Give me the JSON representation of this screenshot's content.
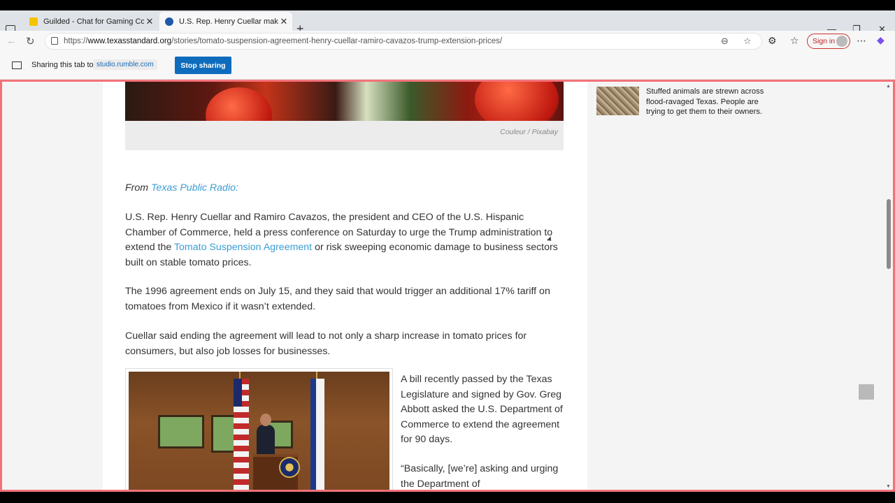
{
  "browser": {
    "tabs": [
      {
        "title": "Guilded - Chat for Gaming Comm",
        "active": false,
        "favicon": "guilded-icon",
        "favicon_color": "#f5c400"
      },
      {
        "title": "U.S. Rep. Henry Cuellar make",
        "active": true,
        "favicon": "texas-standard-icon",
        "favicon_color": "#1e5aa8"
      }
    ],
    "new_tab_label": "+",
    "url_prefix": "https://",
    "url_domain": "www.texasstandard.org",
    "url_path": "/stories/tomato-suspension-agreement-henry-cuellar-ramiro-cavazos-trump-extension-prices/",
    "sign_in_label": "Sign in"
  },
  "sharing": {
    "label": "Sharing this tab to",
    "domain": "studio.rumble.com",
    "stop_label": "Stop sharing"
  },
  "article": {
    "photo_credit": "Couleur / Pixabay",
    "from_prefix": "From",
    "from_source": "Texas Public Radio:",
    "p1_a": "U.S. Rep. Henry Cuellar and Ramiro Cavazos, the president and CEO of the U.S. Hispanic Chamber of Commerce, held a press conference on Saturday to urge the Trump administration to extend the ",
    "p1_link": "Tomato Suspension Agreement",
    "p1_b": " or risk sweeping economic damage to business sectors built on stable tomato prices.",
    "p2": "The 1996 agreement ends on July 15, and they said that would trigger an additional 17% tariff on tomatoes from Mexico if it wasn’t extended.",
    "p3": "Cuellar said ending the agreement will lead to not only a sharp increase in tomato prices for consumers, but also job losses for businesses.",
    "p4": "A bill recently passed by the Texas Legislature and signed by Gov. Greg Abbott asked the U.S. Department of Commerce to extend the agreement for 90 days.",
    "p5": "“Basically, [we’re] asking and urging the Department of"
  },
  "sidebar": {
    "story_title": "Stuffed animals are strewn across flood-ravaged Texas. People are trying to get them to their owners."
  },
  "colors": {
    "link": "#3b9dd1",
    "share_frame": "#f3727a",
    "stop_button": "#0f6cbd"
  }
}
